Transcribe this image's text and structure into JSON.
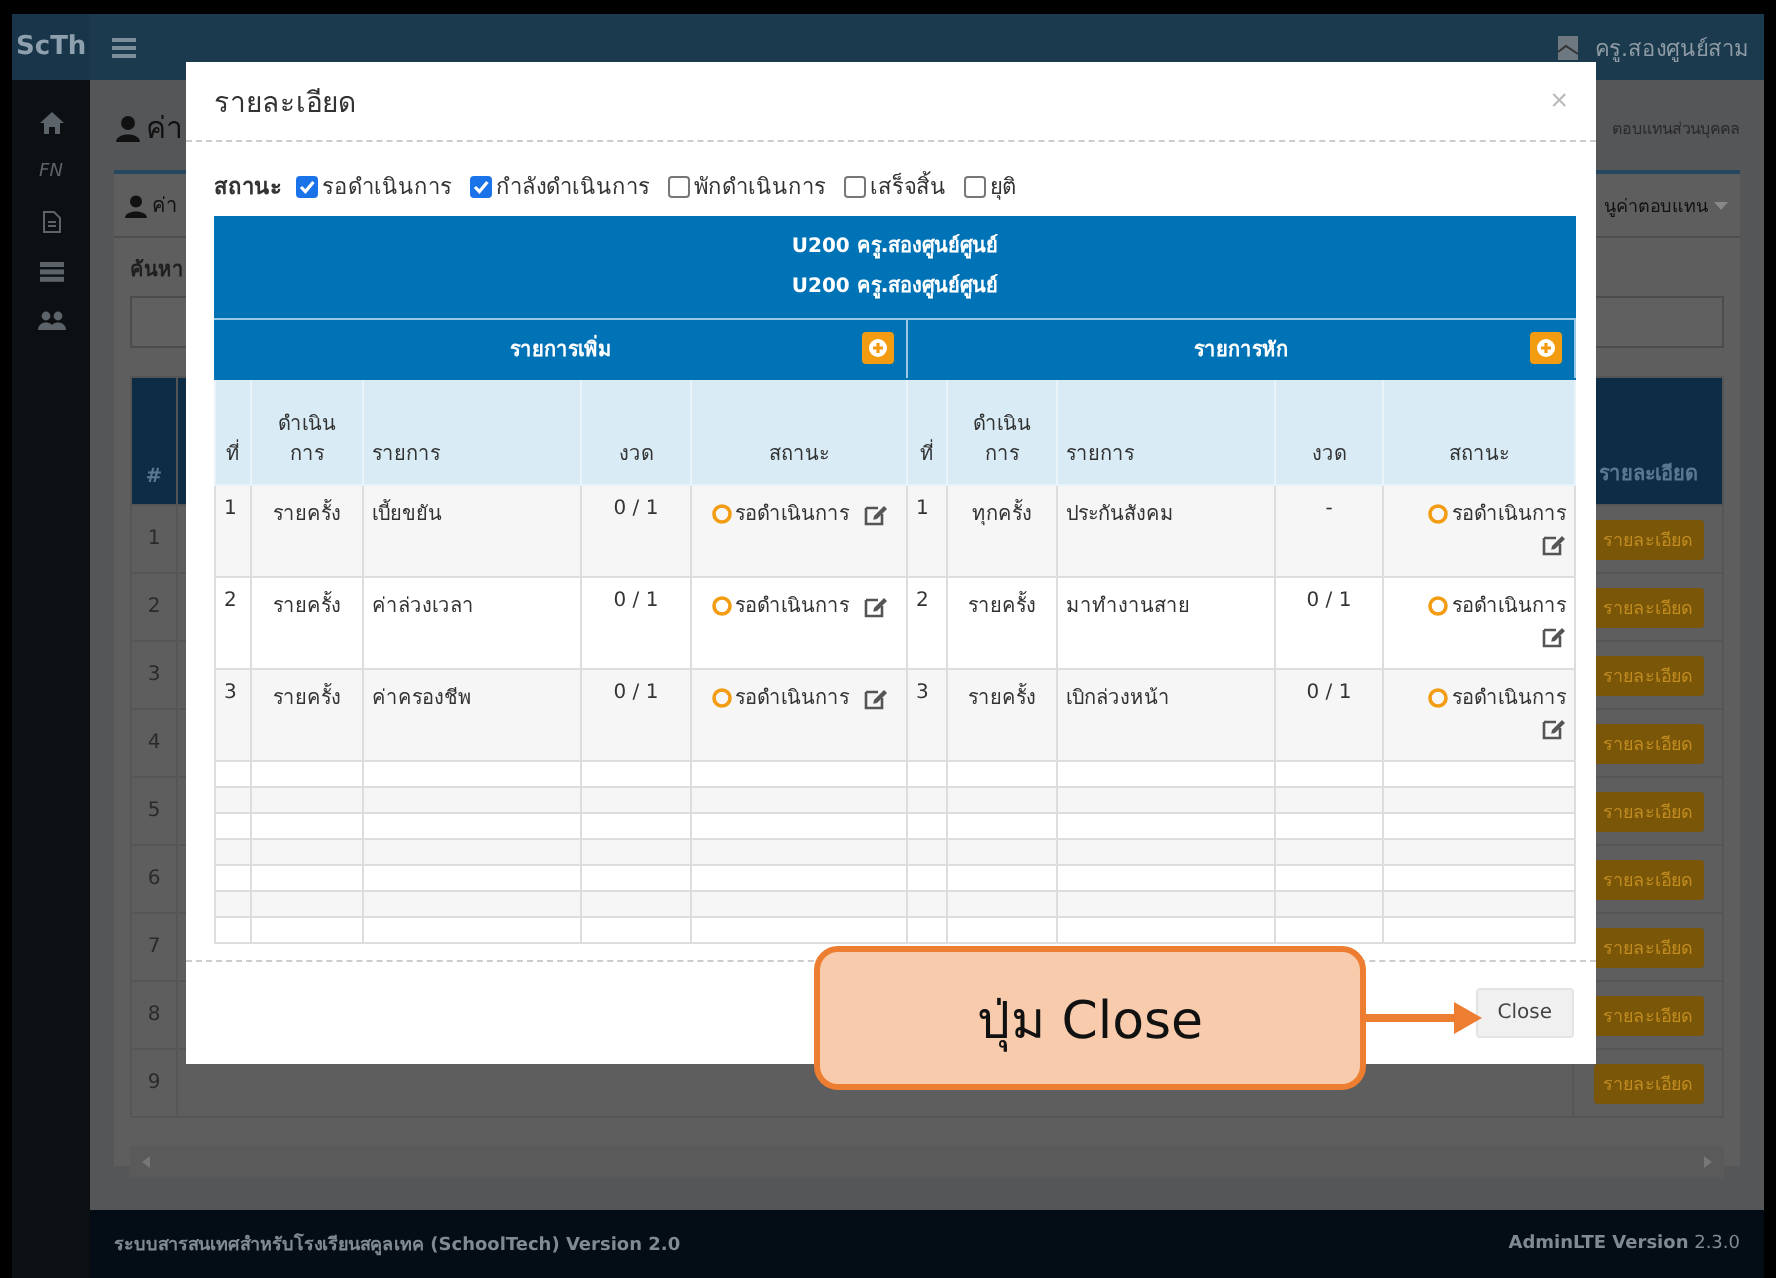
{
  "header": {
    "logo": "ScTh",
    "user": "ครู.สองศูนย์สาม"
  },
  "sidebar": {
    "label": "FN"
  },
  "page": {
    "heading": "ค่า",
    "breadcrumb": "ตอบแทนส่วนบุคคล"
  },
  "box": {
    "title": "ค่า",
    "menu": "นูค่าตอบแทน",
    "search_label": "ค้นหา",
    "table": {
      "columns": [
        "#",
        "รายละเอียด"
      ],
      "rows": [
        {
          "no": "1",
          "button": "รายละเอียด"
        },
        {
          "no": "2",
          "button": "รายละเอียด"
        },
        {
          "no": "3",
          "button": "รายละเอียด"
        },
        {
          "no": "4",
          "button": "รายละเอียด"
        },
        {
          "no": "5",
          "button": "รายละเอียด"
        },
        {
          "no": "6",
          "button": "รายละเอียด"
        },
        {
          "no": "7",
          "button": "รายละเอียด"
        },
        {
          "no": "8",
          "button": "รายละเอียด"
        },
        {
          "no": "9",
          "button": "รายละเอียด"
        }
      ]
    }
  },
  "modal": {
    "title": "รายละเอียด",
    "close_glyph": "×",
    "status_filter": {
      "label": "สถานะ",
      "options": [
        {
          "label": "รอดำเนินการ",
          "checked": true
        },
        {
          "label": "กำลังดำเนินการ",
          "checked": true
        },
        {
          "label": "พักดำเนินการ",
          "checked": false
        },
        {
          "label": "เสร็จสิ้น",
          "checked": false
        },
        {
          "label": "ยุติ",
          "checked": false
        }
      ]
    },
    "table": {
      "title_lines": [
        "U200 ครู.สองศูนย์ศูนย์",
        "U200 ครู.สองศูนย์ศูนย์"
      ],
      "sections": [
        {
          "title": "รายการเพิ่ม",
          "columns": [
            "ที่",
            "ดำเนินการ",
            "รายการ",
            "งวด",
            "สถานะ"
          ],
          "rows": [
            {
              "no": "1",
              "mode": "รายครั้ง",
              "item": "เบี้ยขยัน",
              "period": "0 / 1",
              "status": "รอดำเนินการ"
            },
            {
              "no": "2",
              "mode": "รายครั้ง",
              "item": "ค่าล่วงเวลา",
              "period": "0 / 1",
              "status": "รอดำเนินการ"
            },
            {
              "no": "3",
              "mode": "รายครั้ง",
              "item": "ค่าครองชีพ",
              "period": "0 / 1",
              "status": "รอดำเนินการ"
            }
          ]
        },
        {
          "title": "รายการหัก",
          "columns": [
            "ที่",
            "ดำเนินการ",
            "รายการ",
            "งวด",
            "สถานะ"
          ],
          "rows": [
            {
              "no": "1",
              "mode": "ทุกครั้ง",
              "item": "ประกันสังคม",
              "period": "-",
              "status": "รอดำเนินการ"
            },
            {
              "no": "2",
              "mode": "รายครั้ง",
              "item": "มาทำงานสาย",
              "period": "0 / 1",
              "status": "รอดำเนินการ"
            },
            {
              "no": "3",
              "mode": "รายครั้ง",
              "item": "เบิกล่วงหน้า",
              "period": "0 / 1",
              "status": "รอดำเนินการ"
            }
          ]
        }
      ]
    },
    "close_button": "Close"
  },
  "callout": {
    "text": "ปุ่ม Close"
  },
  "footer": {
    "left": "ระบบสารสนเทศสำหรับโรงเรียนสคูลเทค (SchoolTech) Version 2.0",
    "right": "**AdminLTE Version** 2.3.0"
  }
}
